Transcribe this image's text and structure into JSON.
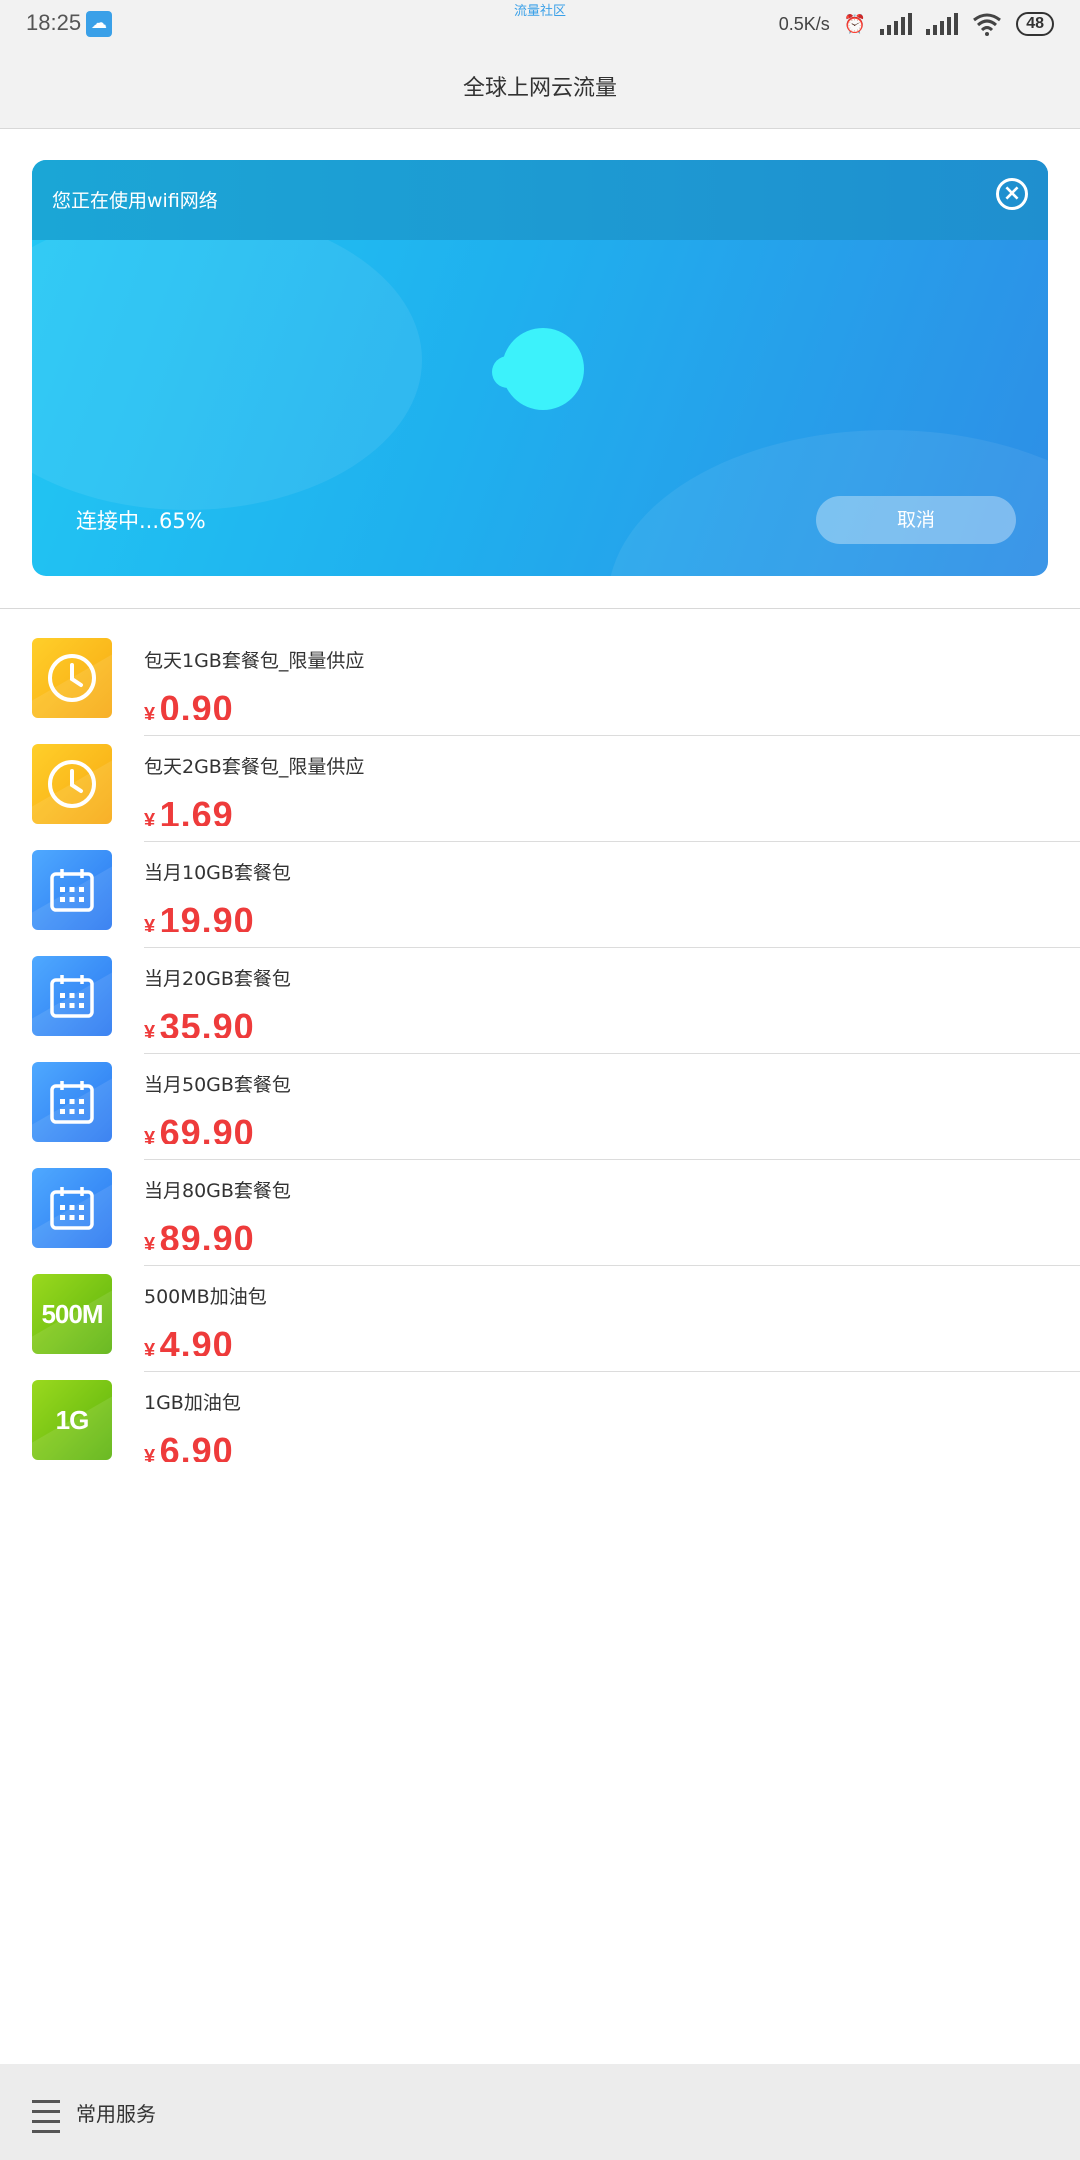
{
  "status_bar": {
    "time": "18:25",
    "notification": "流量社区",
    "net_speed": "0.5K/s",
    "battery": "48"
  },
  "header": {
    "title": "全球上网云流量"
  },
  "connection_card": {
    "network_message": "您正在使用wifi网络",
    "progress_text": "连接中...65%",
    "progress": 0.65,
    "cancel_label": "取消"
  },
  "packages": [
    {
      "name": "包天1GB套餐包_限量供应",
      "currency": "¥",
      "price": "0.90",
      "icon": "clock-icon",
      "icon_text": ""
    },
    {
      "name": "包天2GB套餐包_限量供应",
      "currency": "¥",
      "price": "1.69",
      "icon": "clock-icon",
      "icon_text": ""
    },
    {
      "name": "当月10GB套餐包",
      "currency": "¥",
      "price": "19.90",
      "icon": "calendar-icon",
      "icon_text": ""
    },
    {
      "name": "当月20GB套餐包",
      "currency": "¥",
      "price": "35.90",
      "icon": "calendar-icon",
      "icon_text": ""
    },
    {
      "name": "当月50GB套餐包",
      "currency": "¥",
      "price": "69.90",
      "icon": "calendar-icon",
      "icon_text": ""
    },
    {
      "name": "当月80GB套餐包",
      "currency": "¥",
      "price": "89.90",
      "icon": "calendar-icon",
      "icon_text": ""
    },
    {
      "name": "500MB加油包",
      "currency": "¥",
      "price": "4.90",
      "icon": "text-badge-icon",
      "icon_text": "500M"
    },
    {
      "name": "1GB加油包",
      "currency": "¥",
      "price": "6.90",
      "icon": "text-badge-icon",
      "icon_text": "1G"
    }
  ],
  "footer": {
    "label": "常用服务"
  },
  "colors": {
    "price_red": "#ee3b3b",
    "card_blue": "#1fb0ee",
    "orb_cyan": "#3cf2fb"
  }
}
